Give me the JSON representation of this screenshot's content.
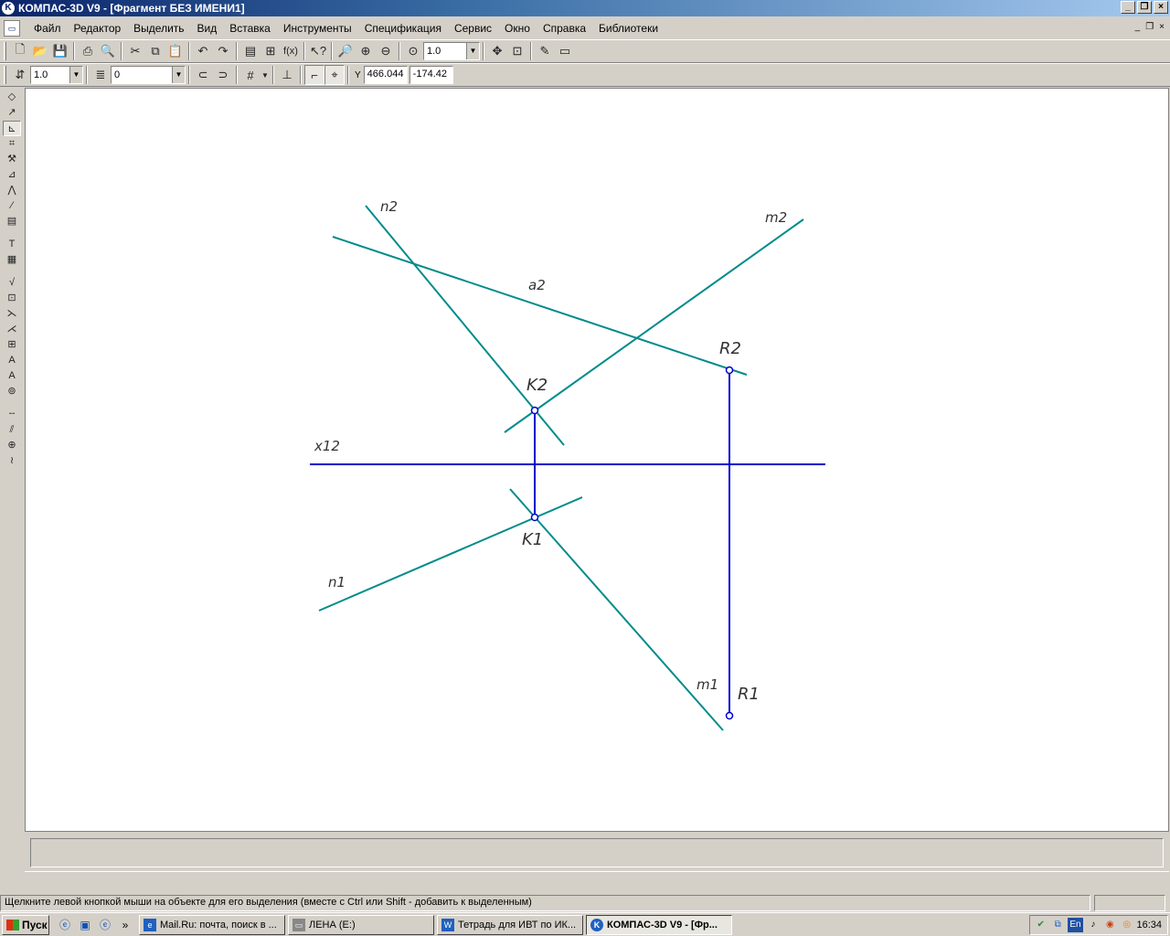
{
  "window": {
    "title": "КОМПАС-3D V9 - [Фрагмент БЕЗ ИМЕНИ1]",
    "app_icon": "kompas-logo-icon",
    "buttons": [
      "minimize",
      "maximize",
      "close"
    ]
  },
  "menu": {
    "items": [
      {
        "label": "Файл"
      },
      {
        "label": "Редактор"
      },
      {
        "label": "Выделить"
      },
      {
        "label": "Вид"
      },
      {
        "label": "Вставка"
      },
      {
        "label": "Инструменты"
      },
      {
        "label": "Спецификация"
      },
      {
        "label": "Сервис"
      },
      {
        "label": "Окно"
      },
      {
        "label": "Справка"
      },
      {
        "label": "Библиотеки"
      }
    ]
  },
  "toolbar_standard": {
    "zoom_value": "1.0",
    "fx_label": "f(x)"
  },
  "toolbar_current_state": {
    "step_value": "1.0",
    "layer_value": "0",
    "coord_label": "Y",
    "coord_x": "466.044",
    "coord_y": "-174.42"
  },
  "drawing": {
    "line_color": "#008b8b",
    "link_color": "#0000cd",
    "labels": {
      "n2": "n2",
      "m2": "m2",
      "a2": "a2",
      "r2": "R2",
      "k2": "K2",
      "x12": "x12",
      "k1": "K1",
      "n1": "n1",
      "m1": "m1",
      "r1": "R1"
    }
  },
  "status": {
    "message": "Щелкните левой кнопкой мыши на объекте для его выделения (вместе с Ctrl или Shift - добавить к выделенным)"
  },
  "taskbar": {
    "start_label": "Пуск",
    "tasks": [
      {
        "label": "Mail.Ru: почта, поиск в ...",
        "icon": "ie-icon"
      },
      {
        "label": "ЛЕНА (E:)",
        "icon": "drive-icon"
      },
      {
        "label": "Тетрадь для ИВТ по ИК...",
        "icon": "word-icon"
      },
      {
        "label": "КОМПАС-3D V9 - [Фр...",
        "icon": "kompas-icon",
        "active": true
      }
    ],
    "lang": "En",
    "clock": "16:34"
  }
}
